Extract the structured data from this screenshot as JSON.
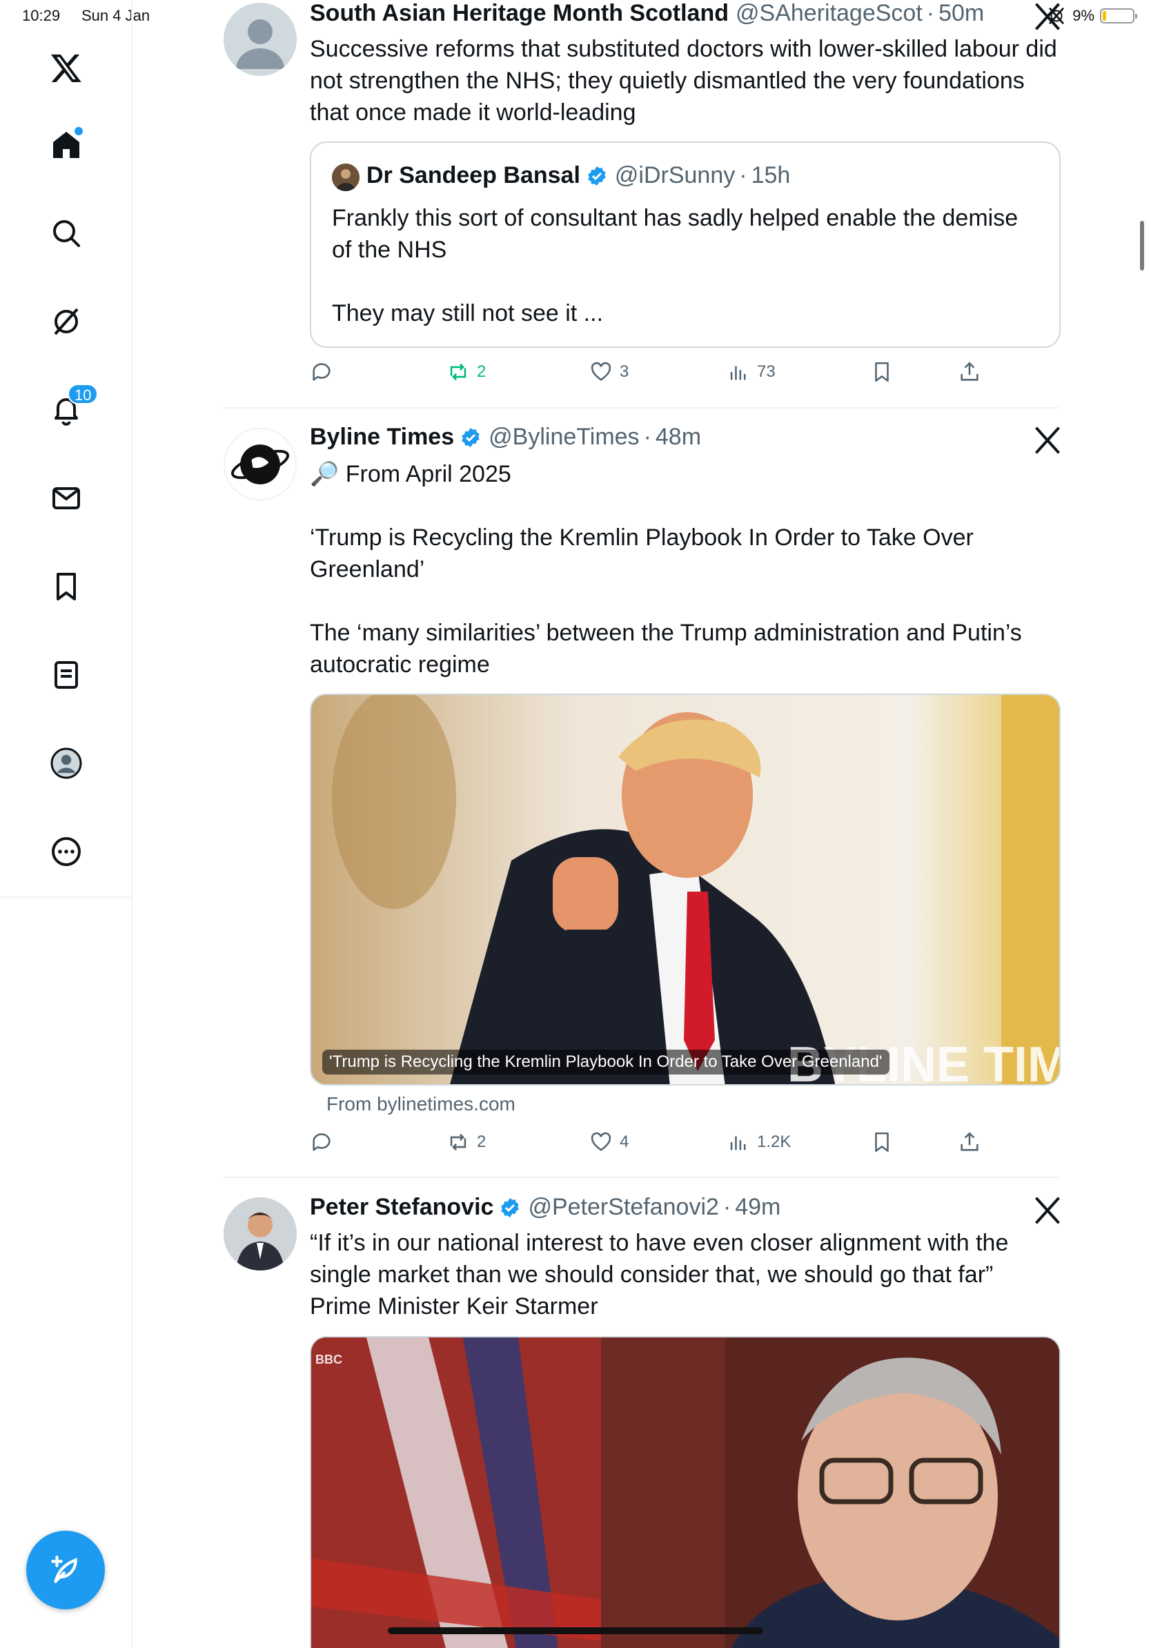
{
  "status_bar": {
    "time": "10:29",
    "date": "Sun 4 Jan",
    "battery": "9%",
    "battery_level": 0.09
  },
  "sidebar": {
    "items": [
      {
        "name": "x-logo"
      },
      {
        "name": "home",
        "has_dot": true
      },
      {
        "name": "explore"
      },
      {
        "name": "grok"
      },
      {
        "name": "notifications",
        "badge": "10"
      },
      {
        "name": "messages"
      },
      {
        "name": "bookmarks"
      },
      {
        "name": "articles"
      },
      {
        "name": "profile"
      },
      {
        "name": "more"
      }
    ],
    "compose_label": "Post"
  },
  "posts": [
    {
      "name": "South Asian Heritage Month Scotland",
      "handle": "@SAheritageScot",
      "time": "50m",
      "verified": false,
      "text": "Successive reforms that substituted doctors with lower-skilled labour did not strengthen the NHS; they quietly dismantled the very foundations that once made it world-leading",
      "quote": {
        "name": "Dr Sandeep Bansal",
        "handle": "@iDrSunny",
        "time": "15h",
        "text": "Frankly this sort of consultant has sadly helped enable the demise of the NHS\n\nThey may still not see it ..."
      },
      "actions": {
        "replies": "",
        "reposts": "2",
        "likes": "3",
        "views": "73",
        "reposted": true
      }
    },
    {
      "name": "Byline Times",
      "handle": "@BylineTimes",
      "time": "48m",
      "verified": true,
      "text": "🔎 From April 2025\n\n‘Trump is Recycling the Kremlin Playbook In Order to Take Over Greenland’\n\nThe ‘many similarities’ between the Trump administration and Putin’s autocratic regime",
      "media_caption": "'Trump is Recycling the Kremlin Playbook In Order to Take Over Greenland'",
      "media_watermark": "BYLINE TIMES",
      "link_source": "From bylinetimes.com",
      "actions": {
        "replies": "",
        "reposts": "2",
        "likes": "4",
        "views": "1.2K",
        "reposted": false
      }
    },
    {
      "name": "Peter Stefanovic",
      "handle": "@PeterStefanovi2",
      "time": "49m",
      "verified": true,
      "text": "“If it’s in our national interest to have even closer alignment with the single market than we should consider that, we should go that far”\nPrime Minister Keir Starmer",
      "media_watermark": "BBC"
    }
  ],
  "colors": {
    "accent": "#1d9bf0",
    "text": "#0f1419",
    "muted": "#536471",
    "repost_green": "#00ba7c",
    "border": "#eff3f4"
  }
}
